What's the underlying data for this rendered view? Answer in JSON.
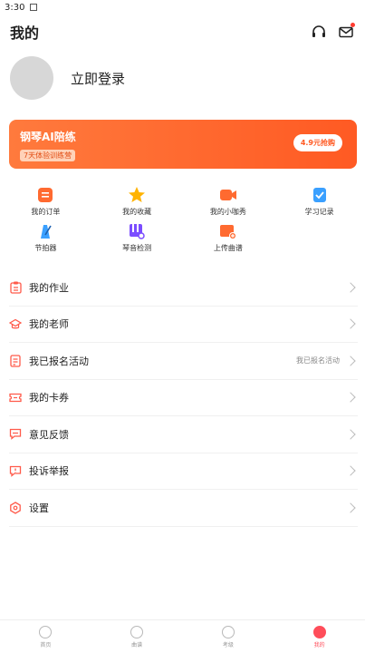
{
  "status_bar": {
    "time": "3:30"
  },
  "header": {
    "title": "我的",
    "headset_icon": "headphones-icon",
    "mail_icon": "mail-icon"
  },
  "profile": {
    "login_label": "立即登录"
  },
  "promo": {
    "title": "钢琴AI陪练",
    "subtitle": "7天体验训练营",
    "button": "4.9元抢购",
    "color": "#ff5a23"
  },
  "grid": [
    {
      "label": "我的订单",
      "icon": "order-icon",
      "color": "#ff6a30"
    },
    {
      "label": "我的收藏",
      "icon": "star-icon",
      "color": "#ffb300"
    },
    {
      "label": "我的小咖秀",
      "icon": "video-icon",
      "color": "#ff6a30"
    },
    {
      "label": "学习记录",
      "icon": "record-icon",
      "color": "#3aa0ff"
    },
    {
      "label": "节拍器",
      "icon": "metronome-icon",
      "color": "#3aa0ff"
    },
    {
      "label": "琴音检测",
      "icon": "piano-check-icon",
      "color": "#7b4dff"
    },
    {
      "label": "上传曲谱",
      "icon": "upload-score-icon",
      "color": "#ff6a30"
    }
  ],
  "menu": [
    {
      "label": "我的作业",
      "right": "",
      "icon": "homework-icon"
    },
    {
      "label": "我的老师",
      "right": "",
      "icon": "teacher-icon"
    },
    {
      "label": "我已报名活动",
      "right": "我已报名活动",
      "icon": "activity-icon"
    },
    {
      "label": "我的卡券",
      "right": "",
      "icon": "coupon-icon"
    },
    {
      "label": "意见反馈",
      "right": "",
      "icon": "feedback-icon"
    },
    {
      "label": "投诉举报",
      "right": "",
      "icon": "report-icon"
    },
    {
      "label": "设置",
      "right": "",
      "icon": "settings-icon"
    }
  ],
  "tabs": [
    {
      "label": "首页",
      "icon": "home-icon",
      "active": false
    },
    {
      "label": "曲谱",
      "icon": "score-icon",
      "active": false
    },
    {
      "label": "考级",
      "icon": "exam-icon",
      "active": false
    },
    {
      "label": "我的",
      "icon": "profile-icon",
      "active": true
    }
  ],
  "colors": {
    "accent": "#ff4d5a",
    "promo": "#ff5a23"
  }
}
